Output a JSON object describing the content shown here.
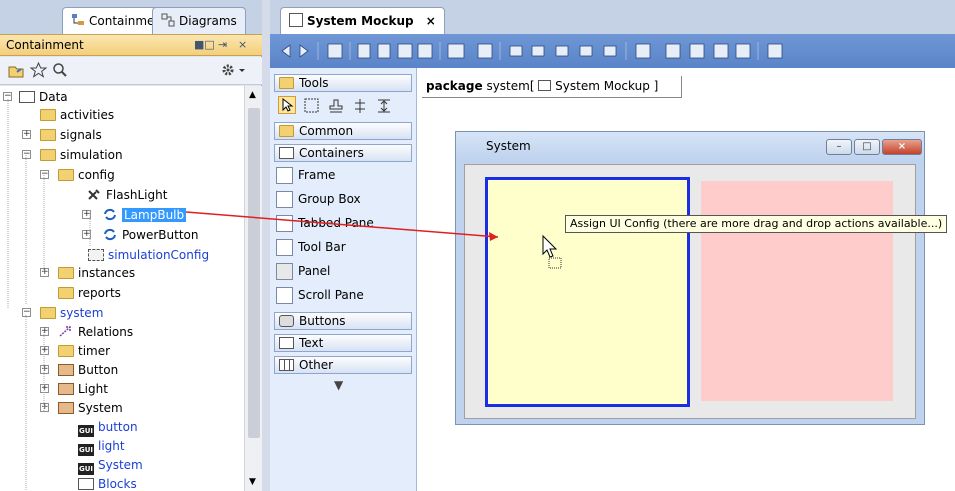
{
  "left_tabs": [
    {
      "label": "Containment",
      "icon": "containment-tree-icon",
      "active": true
    },
    {
      "label": "Diagrams",
      "icon": "diagrams-icon",
      "active": false
    }
  ],
  "panel": {
    "title": "Containment",
    "controls": [
      "■□",
      "⇥",
      "×"
    ]
  },
  "left_toolbar": {
    "icons": [
      "browse-icon",
      "favorite-star-icon",
      "search-icon",
      "settings-gear-icon"
    ]
  },
  "tree": {
    "root": "Data",
    "items": [
      {
        "label": "activities"
      },
      {
        "label": "signals"
      },
      {
        "label": "simulation"
      },
      {
        "label": "config"
      },
      {
        "label": "FlashLight"
      },
      {
        "label": "LampBulb"
      },
      {
        "label": "PowerButton"
      },
      {
        "label": "simulationConfig"
      },
      {
        "label": "instances"
      },
      {
        "label": "reports"
      },
      {
        "label": "system"
      },
      {
        "label": "Relations"
      },
      {
        "label": "timer"
      },
      {
        "label": "Button"
      },
      {
        "label": "Light"
      },
      {
        "label": "System"
      },
      {
        "label": "button"
      },
      {
        "label": "light"
      },
      {
        "label": "System"
      },
      {
        "label": "Blocks"
      }
    ]
  },
  "editor_tab": {
    "label": "System Mockup",
    "close": "×"
  },
  "palette": {
    "groups": [
      {
        "label": "Tools"
      },
      {
        "label": "Common"
      },
      {
        "label": "Containers"
      },
      {
        "label": "Buttons"
      },
      {
        "label": "Text"
      },
      {
        "label": "Other"
      }
    ],
    "container_items": [
      "Frame",
      "Group Box",
      "Tabbed Pane",
      "Tool Bar",
      "Panel",
      "Scroll Pane"
    ],
    "more": "▼"
  },
  "diagram": {
    "frame_keyword": "package",
    "frame_name": "system",
    "frame_bracket_open": "[",
    "frame_diagram_name": "System Mockup",
    "frame_bracket_close": "]",
    "window_title": "System",
    "window_buttons": [
      "–",
      "□",
      "×"
    ],
    "tooltip": "Assign UI Config (there are more drag and drop actions available...)"
  },
  "colors": {
    "selection": "#3399ff",
    "link_blue": "#1a3fd6",
    "drag_arrow": "#e02020",
    "panel_yellow": "#ffffcc",
    "panel_pink": "#ffcccc",
    "panel_border": "#1a2ee6"
  }
}
